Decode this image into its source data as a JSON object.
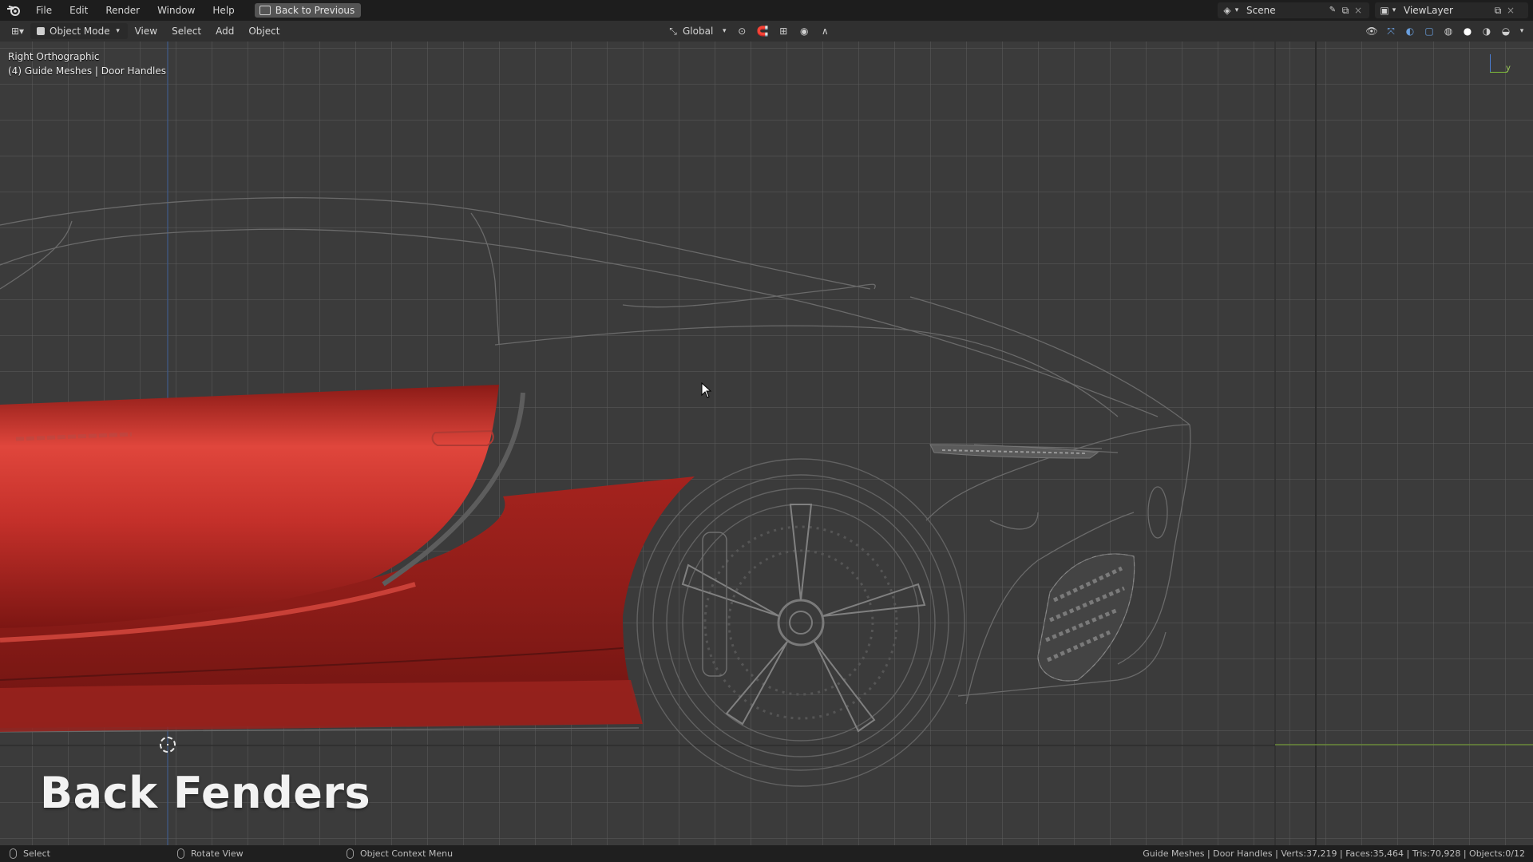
{
  "topbar": {
    "menus": [
      "File",
      "Edit",
      "Render",
      "Window",
      "Help"
    ],
    "back_button": "Back to Previous",
    "scene": "Scene",
    "view_layer": "ViewLayer"
  },
  "header": {
    "mode": "Object Mode",
    "menus": [
      "View",
      "Select",
      "Add",
      "Object"
    ],
    "transform_orientation": "Global"
  },
  "viewport": {
    "view_name": "Right Orthographic",
    "collection_info": "(4) Guide Meshes | Door Handles",
    "axis_label": "y",
    "caption": "Back Fenders"
  },
  "statusbar": {
    "select": "Select",
    "rotate": "Rotate View",
    "context_menu": "Object Context Menu",
    "stats": "Guide Meshes | Door Handles | Verts:37,219 | Faces:35,464 | Tris:70,928 | Objects:0/12"
  },
  "colors": {
    "body_red": "#c4302a",
    "grid_line": "#5a5a5a",
    "background": "#3b3b3b"
  }
}
